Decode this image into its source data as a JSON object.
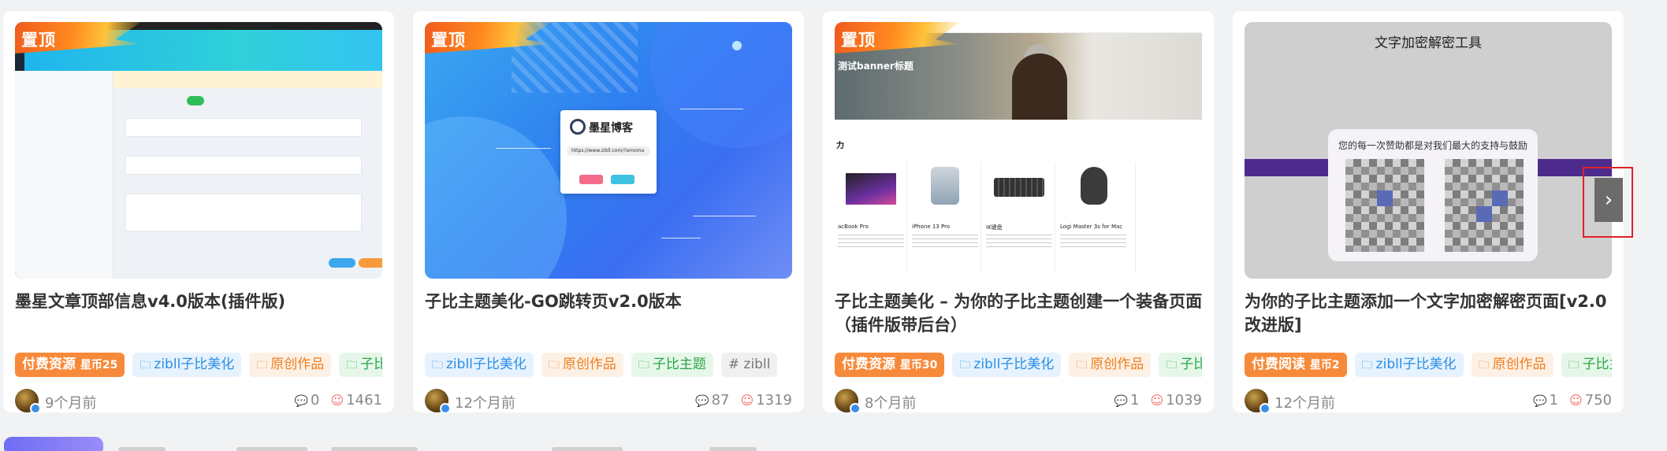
{
  "cards": [
    {
      "pinned_label": "置顶",
      "title": "墨星文章顶部信息v4.0版本(插件版)",
      "tags": [
        {
          "label": "付费资源",
          "extra": "星币25",
          "style": "pay"
        },
        {
          "label": "zibll子比美化",
          "style": "blue"
        },
        {
          "label": "原创作品",
          "style": "orange"
        },
        {
          "label": "子比I",
          "style": "green"
        }
      ],
      "time": "9个月前",
      "comments": "0",
      "likes": "1461"
    },
    {
      "pinned_label": "置顶",
      "title": "子比主题美化-GO跳转页v2.0版本",
      "tags": [
        {
          "label": "zibll子比美化",
          "style": "blue"
        },
        {
          "label": "原创作品",
          "style": "orange"
        },
        {
          "label": "子比主题",
          "style": "green"
        },
        {
          "label": "# zibll",
          "style": "gray"
        }
      ],
      "time": "12个月前",
      "comments": "87",
      "likes": "1319",
      "thumb": {
        "brand": "墨星博客",
        "url": "https://www.zibll.com/?emoma"
      }
    },
    {
      "pinned_label": "置顶",
      "title": "子比主题美化 – 为你的子比主题创建一个装备页面（插件版带后台）",
      "tags": [
        {
          "label": "付费资源",
          "extra": "星币30",
          "style": "pay"
        },
        {
          "label": "zibll子比美化",
          "style": "blue"
        },
        {
          "label": "原创作品",
          "style": "orange"
        },
        {
          "label": "子比I",
          "style": "green"
        }
      ],
      "time": "8个月前",
      "comments": "1",
      "likes": "1039",
      "thumb": {
        "banner_title": "测试banner标题",
        "products": [
          "acBook Pro",
          "iPhone 13 Pro",
          "IK键盘",
          "Logi Master 3s for Mac"
        ]
      }
    },
    {
      "pinned_label": null,
      "title": "为你的子比主题添加一个文字加密解密页面[v2.0改进版]",
      "tags": [
        {
          "label": "付费阅读",
          "extra": "星币2",
          "style": "pay"
        },
        {
          "label": "zibll子比美化",
          "style": "blue"
        },
        {
          "label": "原创作品",
          "style": "orange"
        },
        {
          "label": "子比主",
          "style": "green"
        }
      ],
      "time": "12个月前",
      "comments": "1",
      "likes": "750",
      "thumb": {
        "header": "文字加密解密工具",
        "modal_text": "您的每一次赞助都是对我们最大的支持与鼓励"
      }
    }
  ],
  "next_button": {
    "icon": "chevron-right-icon",
    "glyph": "›"
  }
}
